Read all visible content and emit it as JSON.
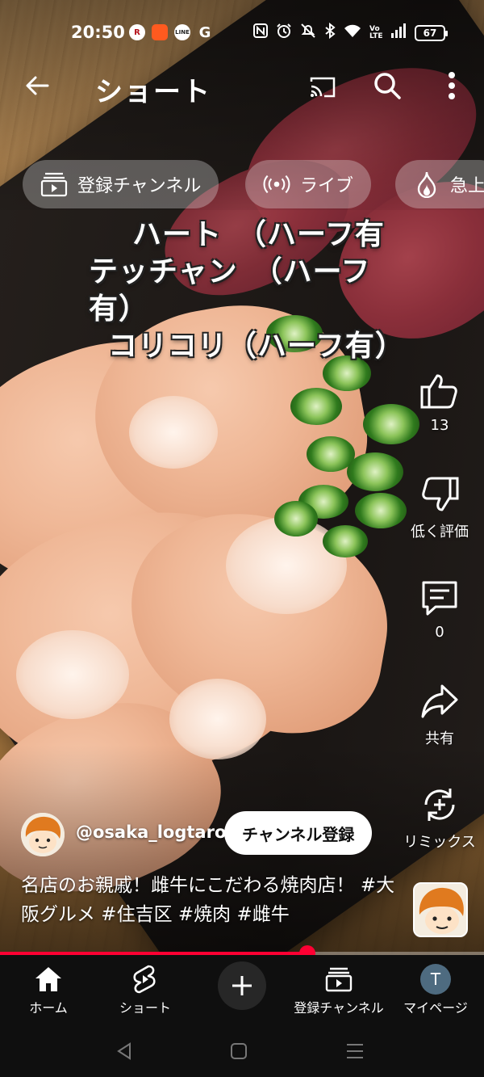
{
  "status_bar": {
    "time": "20:50",
    "left_icons": [
      "rakuten-icon",
      "app-orange-icon",
      "line-icon",
      "google-icon"
    ],
    "right_icons": [
      "nfc-icon",
      "alarm-icon",
      "mute-icon",
      "bluetooth-icon",
      "wifi-icon",
      "volte-icon",
      "signal-icon"
    ],
    "battery": "67",
    "labels": {
      "rakuten": "R",
      "line": "LINE",
      "google": "G",
      "volte": "Vo LTE"
    }
  },
  "header": {
    "title": "ショート",
    "icons": [
      "back-arrow-icon",
      "cast-icon",
      "search-icon",
      "more-vert-icon"
    ]
  },
  "chips": [
    {
      "label": "登録チャンネル",
      "icon": "subscriptions-icon"
    },
    {
      "label": "ライブ",
      "icon": "live-icon"
    },
    {
      "label": "急上",
      "icon": "trending-icon"
    }
  ],
  "video_caption": {
    "line1": "ハート　（ハーフ有",
    "line2": "テッチャン　（ハーフ有）",
    "line3": "コリコリ（ハーフ有）"
  },
  "actions": {
    "like": {
      "icon": "thumb-up-icon",
      "label": "13"
    },
    "dislike": {
      "icon": "thumb-down-icon",
      "label": "低く評価"
    },
    "comments": {
      "icon": "comment-icon",
      "label": "0"
    },
    "share": {
      "icon": "share-icon",
      "label": "共有"
    },
    "remix": {
      "icon": "remix-icon",
      "label": "リミックス"
    }
  },
  "channel": {
    "handle": "@osaka_logtaro",
    "subscribe_label": "チャンネル登録"
  },
  "description": {
    "text": "名店のお親戚！雌牛にこだわる焼肉店！ #大阪グルメ #住吉区 #焼肉 #雌牛"
  },
  "progress": {
    "fraction": 0.635
  },
  "bottom_nav": [
    {
      "label": "ホーム",
      "icon": "home-icon",
      "active": true
    },
    {
      "label": "ショート",
      "icon": "shorts-icon"
    },
    {
      "label": "",
      "icon": "plus-icon"
    },
    {
      "label": "登録チャンネル",
      "icon": "subscriptions-icon"
    },
    {
      "label": "マイページ",
      "icon": "avatar-icon",
      "avatar_letter": "T"
    }
  ],
  "colors": {
    "accent": "#ff0033",
    "nav_background": "#0f0f0f",
    "chip_background": "rgba(230,230,230,0.32)"
  },
  "system_nav": [
    "back-triangle-icon",
    "home-square-icon",
    "recents-menu-icon"
  ]
}
